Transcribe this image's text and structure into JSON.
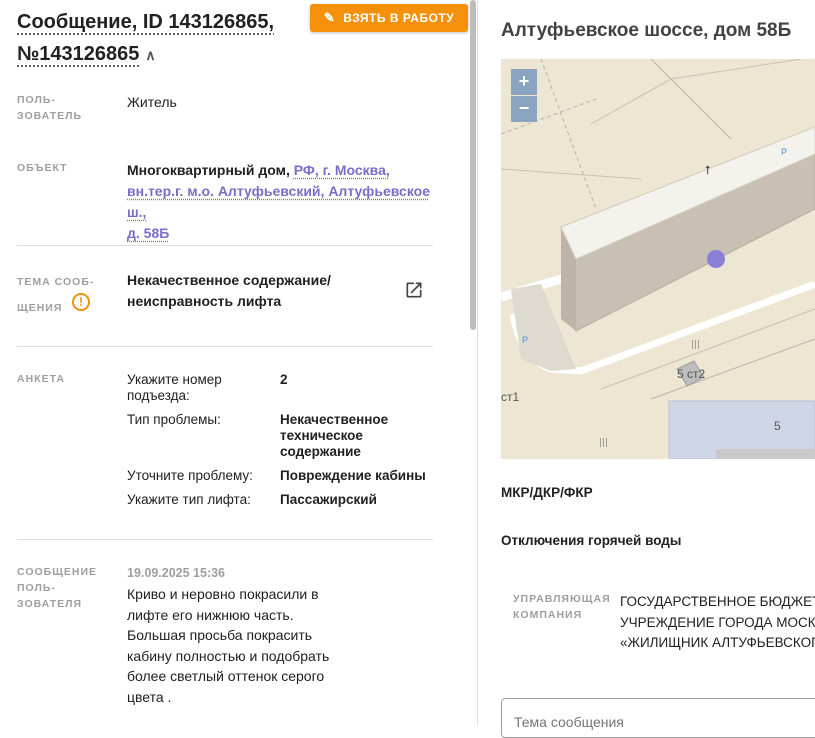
{
  "header": {
    "title_line1": "Сообщение, ID 143126865,",
    "title_line2": "№143126865",
    "take_button": "ВЗЯТЬ В РАБОТУ"
  },
  "fields": {
    "user_label": "ПОЛЬ-\nЗОВАТЕЛЬ",
    "user_value": "Житель",
    "object_label": "ОБЪЕКТ",
    "object_prefix": "Многоквартирный дом,",
    "object_link_1": "РФ, г. Москва,",
    "object_link_2": "вн.тер.г. м.о. Алтуфьевский, Алтуфьевское ш.,",
    "object_link_3": "д. 58Б",
    "topic_label": "ТЕМА СООБ-\nЩЕНИЯ",
    "topic_value": "Некачественное содержание/\nнеисправность лифта",
    "form_label": "АНКЕТА",
    "message_label": "СООБЩЕНИЕ\nПОЛЬ-\nЗОВАТЕЛЯ"
  },
  "survey": [
    {
      "q": "Укажите номер подъезда:",
      "a": "2"
    },
    {
      "q": "Тип проблемы:",
      "a": "Некачественное техническое содержание"
    },
    {
      "q": "Уточните проблему:",
      "a": "Повреждение кабины"
    },
    {
      "q": "Укажите тип лифта:",
      "a": "Пассажирский"
    }
  ],
  "message": {
    "date": "19.09.2025 15:36",
    "text": "Криво и неровно покрасили в лифте его нижнюю часть. Большая просьба покрасить кабину полностью и подобрать более светлый оттенок серого цвета ."
  },
  "right": {
    "address": "Алтуфьевское шоссе, дом 58Б",
    "zoom_in": "+",
    "zoom_out": "−",
    "map_labels": {
      "building_a": "5 ст2",
      "building_b": "5",
      "building_c": "ст1",
      "parking": "P"
    },
    "mkr": "МКР/ДКР/ФКР",
    "hot_water": "Отключения горячей воды",
    "mc_label": "УПРАВЛЯЮЩАЯ\nКОМПАНИЯ",
    "mc_value_1": "ГОСУДАРСТВЕННОЕ БЮДЖЕТН",
    "mc_value_2": "УЧРЕЖДЕНИЕ ГОРОДА МОСКВЫ",
    "mc_value_3": "«ЖИЛИЩНИК АЛТУФЬЕВСКОГО",
    "topic_placeholder": "Тема сообщения"
  },
  "colors": {
    "accent": "#f5900a",
    "link": "#7b6cc7",
    "map_bg": "#ede6d2",
    "marker": "#7b6cc7"
  }
}
